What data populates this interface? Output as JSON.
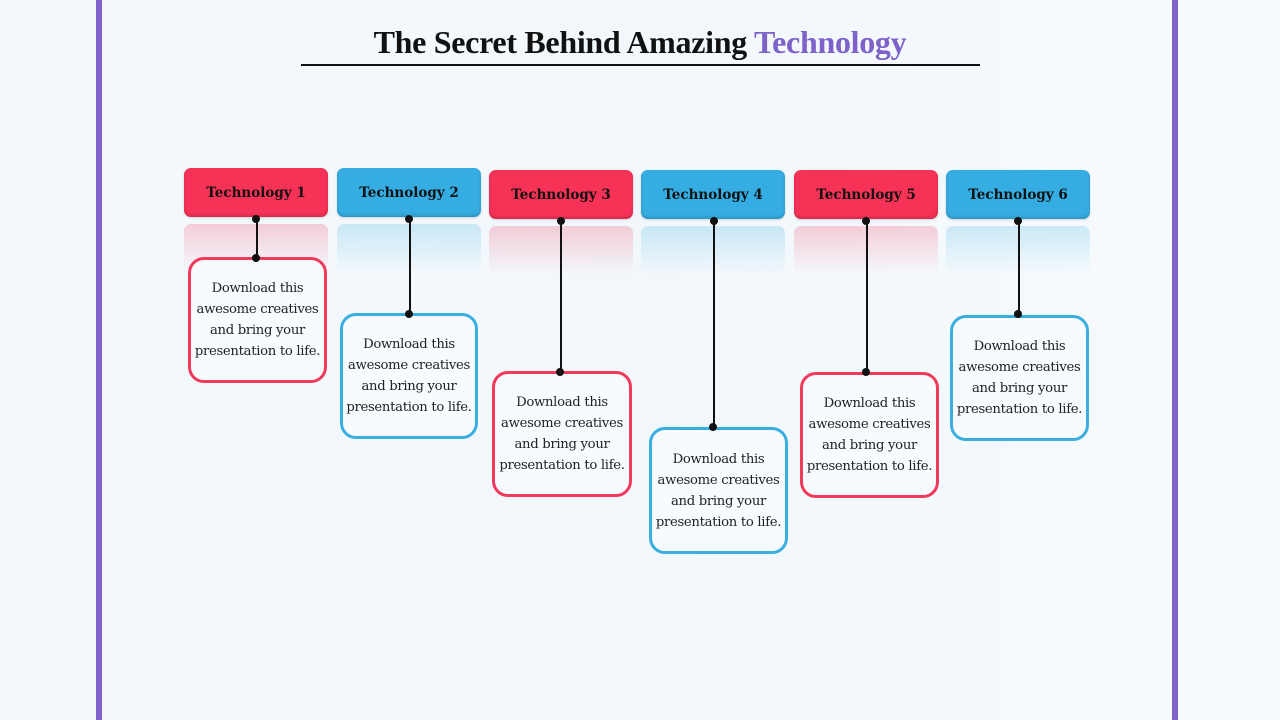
{
  "title": {
    "main": "The Secret Behind Amazing",
    "accent": "Technology"
  },
  "colors": {
    "frame": "#8064cc",
    "accent": "#7c62c9",
    "red": "#f63257",
    "blue": "#36ade2"
  },
  "items": [
    {
      "label": "Technology 1",
      "color": "red",
      "text": "Download this awesome creatives and bring your presentation to life."
    },
    {
      "label": "Technology 2",
      "color": "blue",
      "text": "Download this awesome creatives and bring your presentation to life."
    },
    {
      "label": "Technology 3",
      "color": "red",
      "text": "Download this awesome creatives and bring your presentation to life."
    },
    {
      "label": "Technology 4",
      "color": "blue",
      "text": "Download this awesome creatives and bring your presentation to life."
    },
    {
      "label": "Technology 5",
      "color": "red",
      "text": "Download this awesome creatives and bring your presentation to life."
    },
    {
      "label": "Technology 6",
      "color": "blue",
      "text": "Download this awesome creatives and bring your presentation to life."
    }
  ]
}
